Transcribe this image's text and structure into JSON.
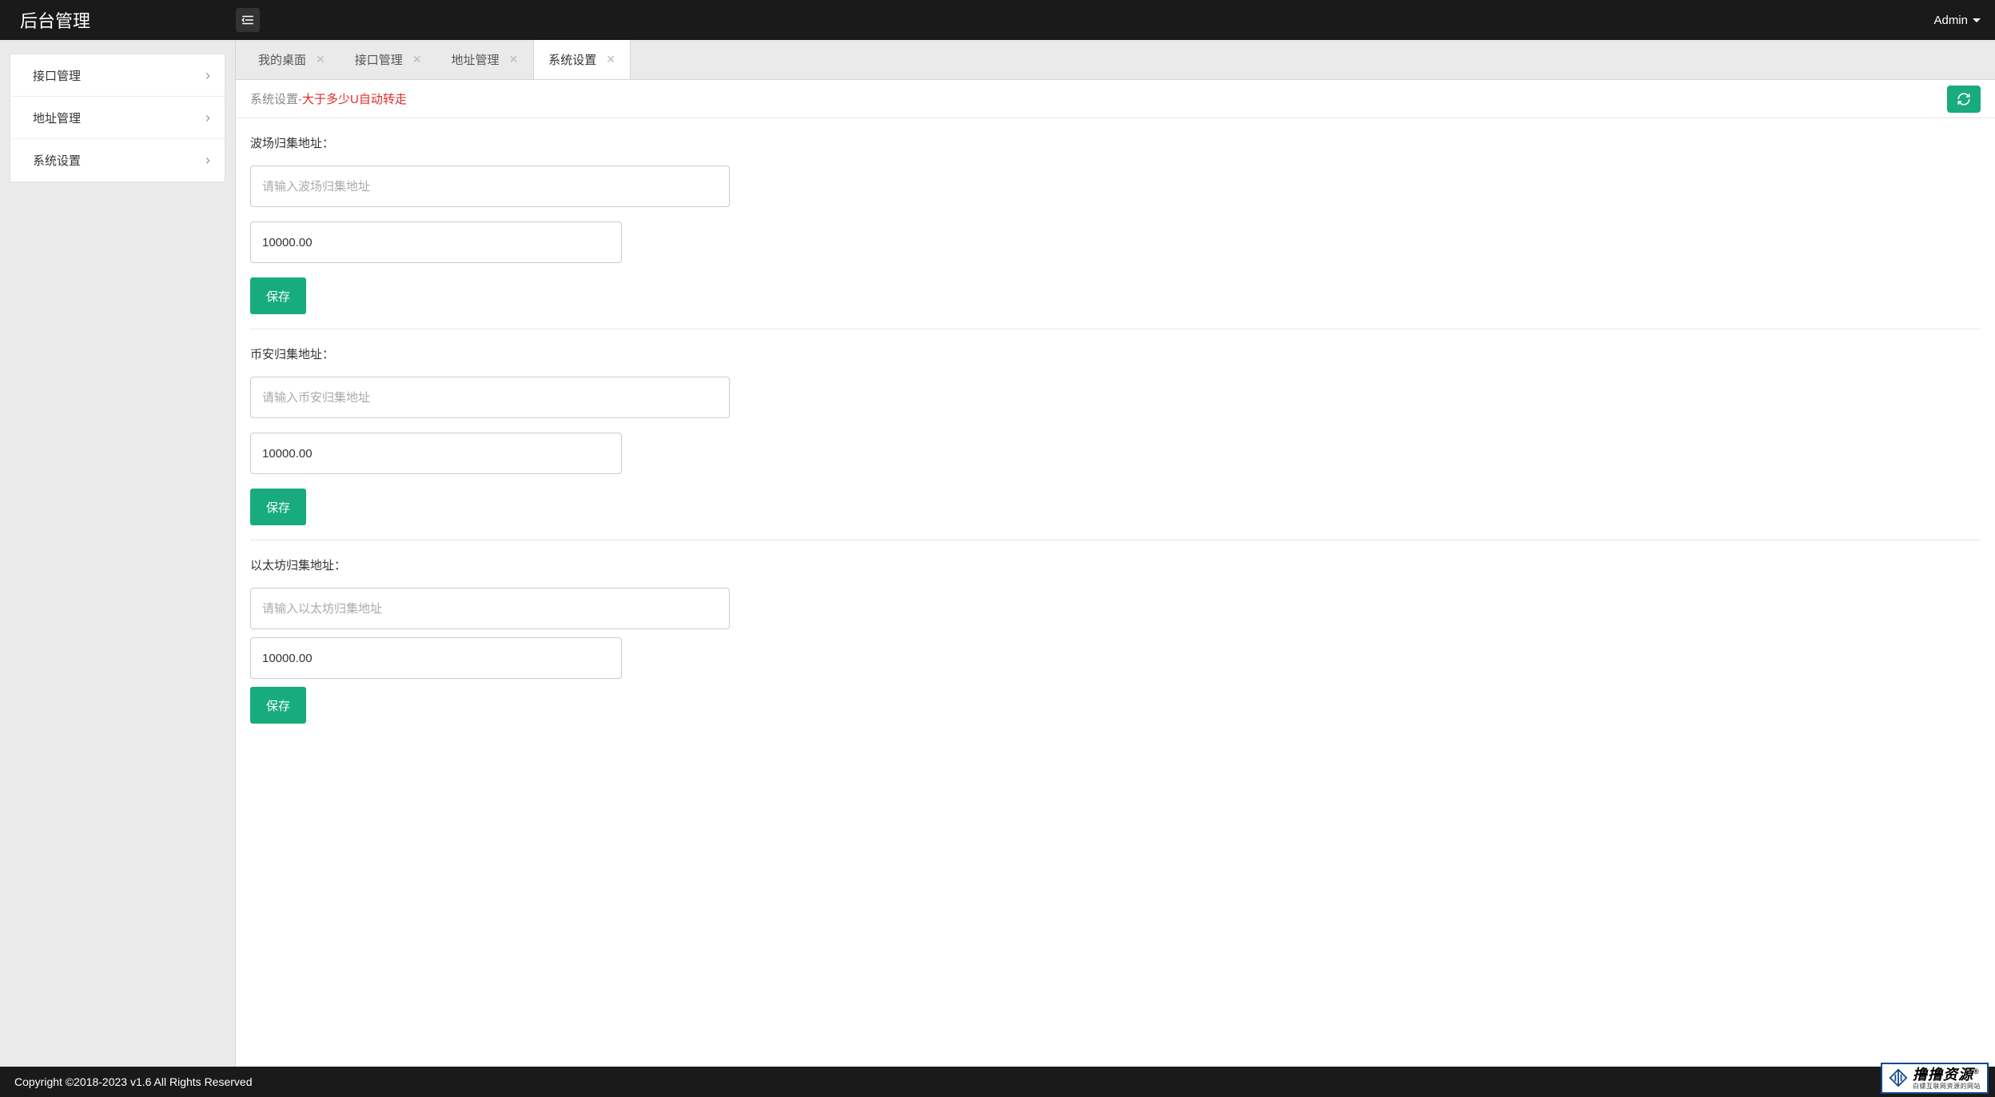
{
  "header": {
    "brand": "后台管理",
    "user": "Admin"
  },
  "sidebar": {
    "items": [
      {
        "label": "接口管理"
      },
      {
        "label": "地址管理"
      },
      {
        "label": "系统设置"
      }
    ]
  },
  "tabs": [
    {
      "label": "我的桌面",
      "active": false
    },
    {
      "label": "接口管理",
      "active": false
    },
    {
      "label": "地址管理",
      "active": false
    },
    {
      "label": "系统设置",
      "active": true
    }
  ],
  "breadcrumb": {
    "prefix": "系统设置-",
    "accent": "大于多少U自动转走"
  },
  "form": {
    "sections": [
      {
        "label": "波场归集地址：",
        "addr_placeholder": "请输入波场归集地址",
        "addr_value": "",
        "amount_value": "10000.00",
        "save_label": "保存"
      },
      {
        "label": "币安归集地址：",
        "addr_placeholder": "请输入币安归集地址",
        "addr_value": "",
        "amount_value": "10000.00",
        "save_label": "保存"
      },
      {
        "label": "以太坊归集地址：",
        "addr_placeholder": "请输入以太坊归集地址",
        "addr_value": "",
        "amount_value": "10000.00",
        "save_label": "保存"
      }
    ]
  },
  "footer": {
    "copyright": "Copyright ©2018-2023 v1.6 All Rights Reserved"
  },
  "watermark": {
    "main": "撸撸资源",
    "sub": "白嫖互联网资源的网站"
  }
}
